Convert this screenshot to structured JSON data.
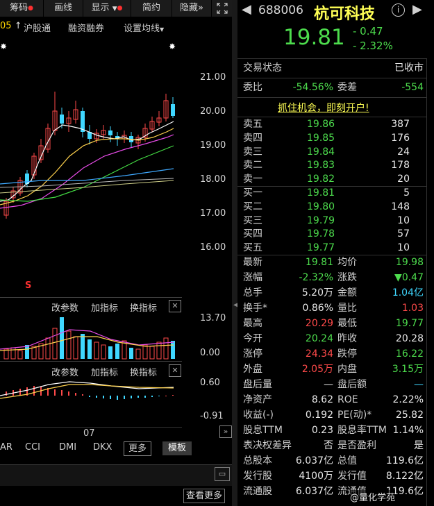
{
  "toolbar": {
    "chip": "筹码",
    "line": "画线",
    "display": "显示",
    "simple": "简约",
    "hide": "隐藏",
    "more_arrows": "»",
    "fullscreen_icon": "expand-icon"
  },
  "subbar": {
    "partial": "05",
    "hsgt": "沪股通",
    "margin": "融资融券",
    "ma_settings": "设置均线"
  },
  "price_axis": [
    "21.00",
    "20.00",
    "19.00",
    "18.00",
    "17.00",
    "16.00"
  ],
  "vol_panel": {
    "change_params": "改参数",
    "add_indicator": "加指标",
    "switch_indicator": "换指标",
    "axis_top": "13.70",
    "axis_bottom": "0.00"
  },
  "macd_panel": {
    "change_params": "改参数",
    "add_indicator": "加指标",
    "switch_indicator": "换指标",
    "axis_top": "0.60",
    "axis_bottom": "-0.91"
  },
  "date_label": "07",
  "indicator_tabs": [
    "AR",
    "CCI",
    "DMI",
    "DKX",
    "更多",
    "模板"
  ],
  "view_more": "查看更多",
  "stock": {
    "code": "688006",
    "name": "杭可科技",
    "price": "19.81",
    "change": "- 0.47",
    "change_pct": "- 2.32%"
  },
  "trade_status": {
    "label": "交易状态",
    "value": "已收市"
  },
  "ratio": {
    "wb_label": "委比",
    "wb_value": "-54.56%",
    "wc_label": "委差",
    "wc_value": "-554"
  },
  "promo": "抓住机会，即刻开户!",
  "sell_orders": [
    {
      "label": "卖五",
      "price": "19.86",
      "qty": "387"
    },
    {
      "label": "卖四",
      "price": "19.85",
      "qty": "176"
    },
    {
      "label": "卖三",
      "price": "19.84",
      "qty": "24"
    },
    {
      "label": "卖二",
      "price": "19.83",
      "qty": "178"
    },
    {
      "label": "卖一",
      "price": "19.82",
      "qty": "20"
    }
  ],
  "buy_orders": [
    {
      "label": "买一",
      "price": "19.81",
      "qty": "5"
    },
    {
      "label": "买二",
      "price": "19.80",
      "qty": "148"
    },
    {
      "label": "买三",
      "price": "19.79",
      "qty": "10"
    },
    {
      "label": "买四",
      "price": "19.78",
      "qty": "57"
    },
    {
      "label": "买五",
      "price": "19.77",
      "qty": "10"
    }
  ],
  "stats": [
    {
      "l1": "最新",
      "v1": "19.81",
      "c1": "green",
      "l2": "均价",
      "v2": "19.98",
      "c2": "green"
    },
    {
      "l1": "涨幅",
      "v1": "-2.32%",
      "c1": "green",
      "l2": "涨跌",
      "v2": "▼0.47",
      "c2": "green"
    },
    {
      "l1": "总手",
      "v1": "5.20万",
      "c1": "white",
      "l2": "金额",
      "v2": "1.04亿",
      "c2": "cyan"
    },
    {
      "l1": "换手*",
      "v1": "0.86%",
      "c1": "white",
      "l2": "量比",
      "v2": "1.03",
      "c2": "red"
    },
    {
      "l1": "最高",
      "v1": "20.29",
      "c1": "red",
      "l2": "最低",
      "v2": "19.77",
      "c2": "green"
    },
    {
      "l1": "今开",
      "v1": "20.24",
      "c1": "green",
      "l2": "昨收",
      "v2": "20.28",
      "c2": "white"
    },
    {
      "l1": "涨停",
      "v1": "24.34",
      "c1": "red",
      "l2": "跌停",
      "v2": "16.22",
      "c2": "green"
    },
    {
      "l1": "外盘",
      "v1": "2.05万",
      "c1": "red",
      "l2": "内盘",
      "v2": "3.15万",
      "c2": "green"
    },
    {
      "l1": "盘后量",
      "v1": "—",
      "c1": "white",
      "l2": "盘后额",
      "v2": "—",
      "c2": "cyan"
    },
    {
      "l1": "净资产",
      "v1": "8.62",
      "c1": "white",
      "l2": "ROE",
      "v2": "2.22%",
      "c2": "white"
    },
    {
      "l1": "收益(-)",
      "v1": "0.192",
      "c1": "white",
      "l2": "PE(动)*",
      "v2": "25.82",
      "c2": "white"
    },
    {
      "l1": "股息TTM",
      "v1": "0.23",
      "c1": "white",
      "l2": "股息率TTM",
      "v2": "1.14%",
      "c2": "white"
    },
    {
      "l1": "表决权差异",
      "v1": "否",
      "c1": "white",
      "l2": "是否盈利",
      "v2": "是",
      "c2": "white"
    },
    {
      "l1": "总股本",
      "v1": "6.037亿",
      "c1": "white",
      "l2": "总值",
      "v2": "119.6亿",
      "c2": "white"
    },
    {
      "l1": "发行股",
      "v1": "4100万",
      "c1": "white",
      "l2": "发行值",
      "v2": "8.122亿",
      "c2": "white"
    },
    {
      "l1": "流通股",
      "v1": "6.037亿",
      "c1": "white",
      "l2": "流通值",
      "v2": "119.6亿",
      "c2": "white"
    }
  ],
  "watermark": "@量化学苑"
}
